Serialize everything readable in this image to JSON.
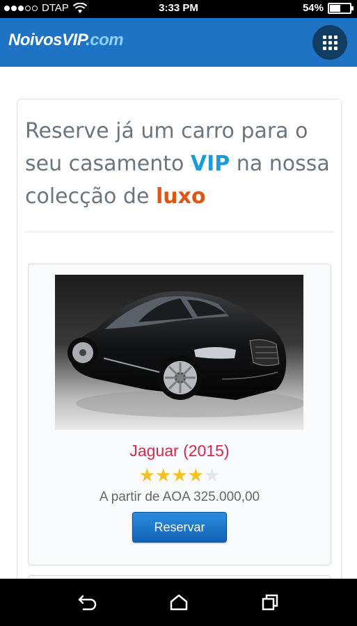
{
  "status_bar": {
    "carrier": "DTAP",
    "time": "3:33 PM",
    "battery_label": "54%",
    "battery_level": 0.54
  },
  "header": {
    "logo_main": "NoivosVIP",
    "logo_tld": ".com",
    "menu_icon": "grid-icon",
    "color": "#1e73c4"
  },
  "hero": {
    "line_part1": "Reserve já um carro para o seu casamento ",
    "vip": "VIP",
    "line_part2": " na nossa colecção de ",
    "luxo": "luxo",
    "vip_color": "#1d9bd8",
    "luxo_color": "#e25416"
  },
  "car": {
    "title": "Jaguar (2015)",
    "rating": 4,
    "rating_max": 5,
    "price": "A partir de AOA 325.000,00",
    "button_label": "Reservar"
  },
  "nav": {
    "back_icon": "back-icon",
    "home_icon": "home-icon",
    "recents_icon": "recents-icon"
  }
}
